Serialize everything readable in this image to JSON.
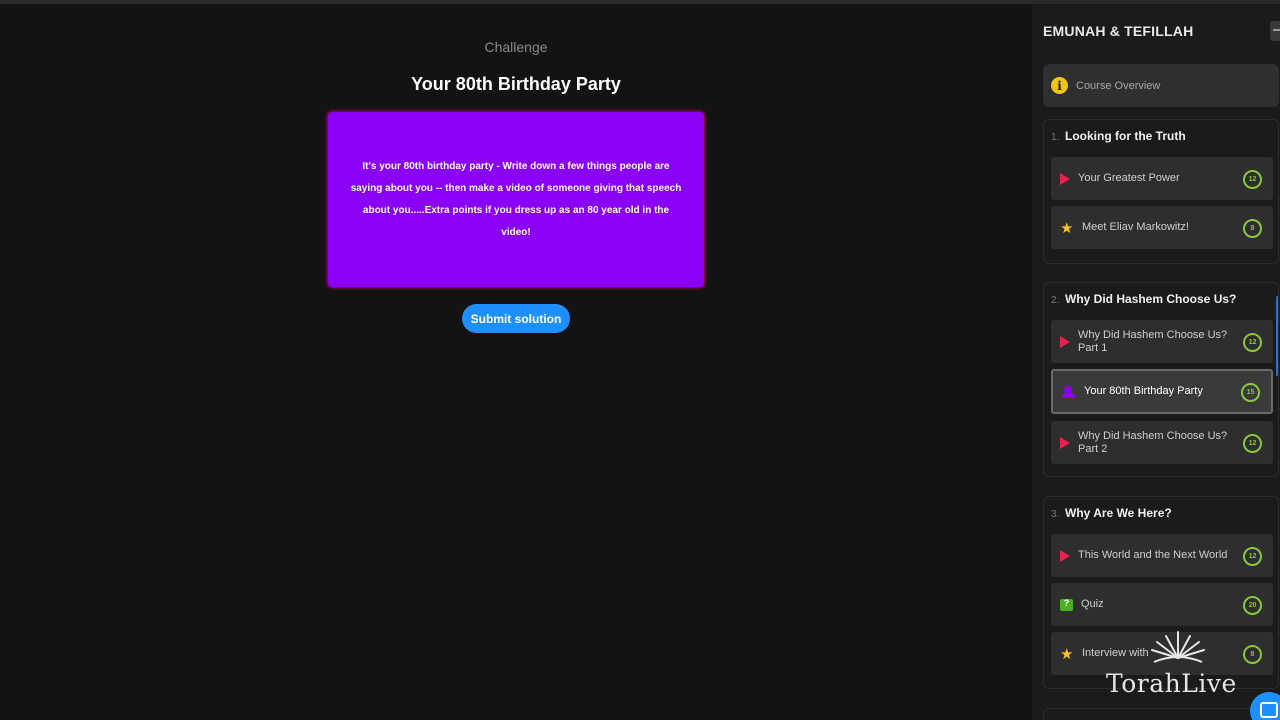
{
  "main": {
    "challenge_label": "Challenge",
    "challenge_title": "Your 80th Birthday Party",
    "challenge_text": "It's your 80th birthday party - Write down a few things people are saying about you -- then make a video of someone giving that speech about you.....Extra points if you dress up as an 80 year old in the video!",
    "card_color": "#8a00f5",
    "submit_label": "Submit solution",
    "accent_color": "#1e8fff"
  },
  "sidebar": {
    "course_title": "EMUNAH & TEFILLAH",
    "overview": {
      "label": "Course Overview",
      "icon": "info-icon"
    },
    "sections": [
      {
        "number": "1.",
        "title": "Looking for the Truth",
        "items": [
          {
            "label": "Your Greatest Power",
            "icon": "play-icon",
            "points": "12",
            "active": false
          },
          {
            "label": "Meet Eliav Markowitz!",
            "icon": "star-icon",
            "points": "8",
            "active": false
          }
        ]
      },
      {
        "number": "2.",
        "title": "Why Did Hashem Choose Us?",
        "items": [
          {
            "label": "Why Did Hashem Choose Us? Part 1",
            "icon": "play-icon",
            "points": "12",
            "active": false
          },
          {
            "label": "Your 80th Birthday Party",
            "icon": "challenge-icon",
            "points": "15",
            "active": true
          },
          {
            "label": "Why Did Hashem Choose Us? Part 2",
            "icon": "play-icon",
            "points": "12",
            "active": false
          }
        ]
      },
      {
        "number": "3.",
        "title": "Why Are We Here?",
        "items": [
          {
            "label": "This World and the Next World",
            "icon": "play-icon",
            "points": "12",
            "active": false
          },
          {
            "label": "Quiz",
            "icon": "quiz-icon",
            "points": "20",
            "active": false
          },
          {
            "label": "Interview with",
            "icon": "star-icon",
            "points": "8",
            "active": false
          }
        ]
      }
    ],
    "points_color": "#8cc63f"
  },
  "watermark": {
    "text": "TorahLive"
  }
}
